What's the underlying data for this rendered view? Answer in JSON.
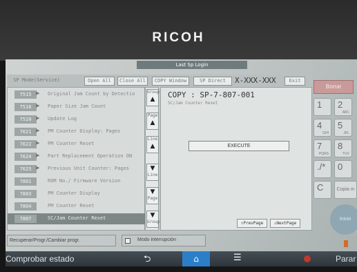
{
  "brand": "RICOH",
  "login_button": "Last Sp Login",
  "title_bar": {
    "mode_title": "SP Mode(Service)",
    "open_all": "Open All",
    "close_all": "Close All",
    "copy_window": "COPY Window",
    "sp_direct": "SP Direct",
    "sp_code": "X-XXX-XXX",
    "exit": "Exit"
  },
  "list": [
    {
      "num": "7515",
      "label": "Original Jam Count by Detectio"
    },
    {
      "num": "7516",
      "label": "Paper Size Jam Count"
    },
    {
      "num": "7520",
      "label": "Update Log"
    },
    {
      "num": "7621",
      "label": "PM Counter Display: Pages"
    },
    {
      "num": "7622",
      "label": "PM Counter Reset"
    },
    {
      "num": "7624",
      "label": "Part Replacement Operation ON"
    },
    {
      "num": "7625",
      "label": "Previous Unit Counter: Pages"
    },
    {
      "num": "7801",
      "label": "ROM No./ Firmware Version"
    },
    {
      "num": "7803",
      "label": "PM Counter Display"
    },
    {
      "num": "7804",
      "label": "PM Counter Reset"
    },
    {
      "num": "7807",
      "label": "SC/Jam Counter Reset",
      "selected": true
    }
  ],
  "nav": [
    {
      "label": "Group",
      "arrow": "▲"
    },
    {
      "label": "Page",
      "arrow": "▲"
    },
    {
      "label": "Line",
      "arrow": "▲"
    },
    {
      "label": "Line",
      "arrow": "▼"
    },
    {
      "label": "Page",
      "arrow": "▼"
    },
    {
      "label": "Group",
      "arrow": "▼"
    }
  ],
  "detail": {
    "code": "COPY : SP-7-807-001",
    "subtitle": "SC/Jam Counter Reset",
    "execute": "EXECUTE",
    "prev_page": "↑PrevPage",
    "next_page": "↓NextPage"
  },
  "keypad": {
    "borrar": "Borrar",
    "keys": [
      {
        "digit": "1",
        "sub": ""
      },
      {
        "digit": "2",
        "sub": "ABC"
      },
      {
        "digit": "4",
        "sub": "GHI"
      },
      {
        "digit": "5",
        "sub": "JKL"
      },
      {
        "digit": "7",
        "sub": "PQRS"
      },
      {
        "digit": "8",
        "sub": "TUV"
      },
      {
        "digit": "./*",
        "sub": ""
      },
      {
        "digit": "0",
        "sub": ""
      },
      {
        "digit": "C",
        "sub": ""
      }
    ],
    "copia": "Copia m",
    "inicio": "Inicio"
  },
  "bottom": {
    "recuperar": "Recuperar/Progr./Cambiar progr.",
    "modo": "Modo interrupción"
  },
  "system_bar": {
    "status": "Comprobar estado",
    "back_icon": "back-arrow-icon",
    "home_icon": "home-icon",
    "menu_icon": "menu-icon",
    "stop": "Parar"
  }
}
